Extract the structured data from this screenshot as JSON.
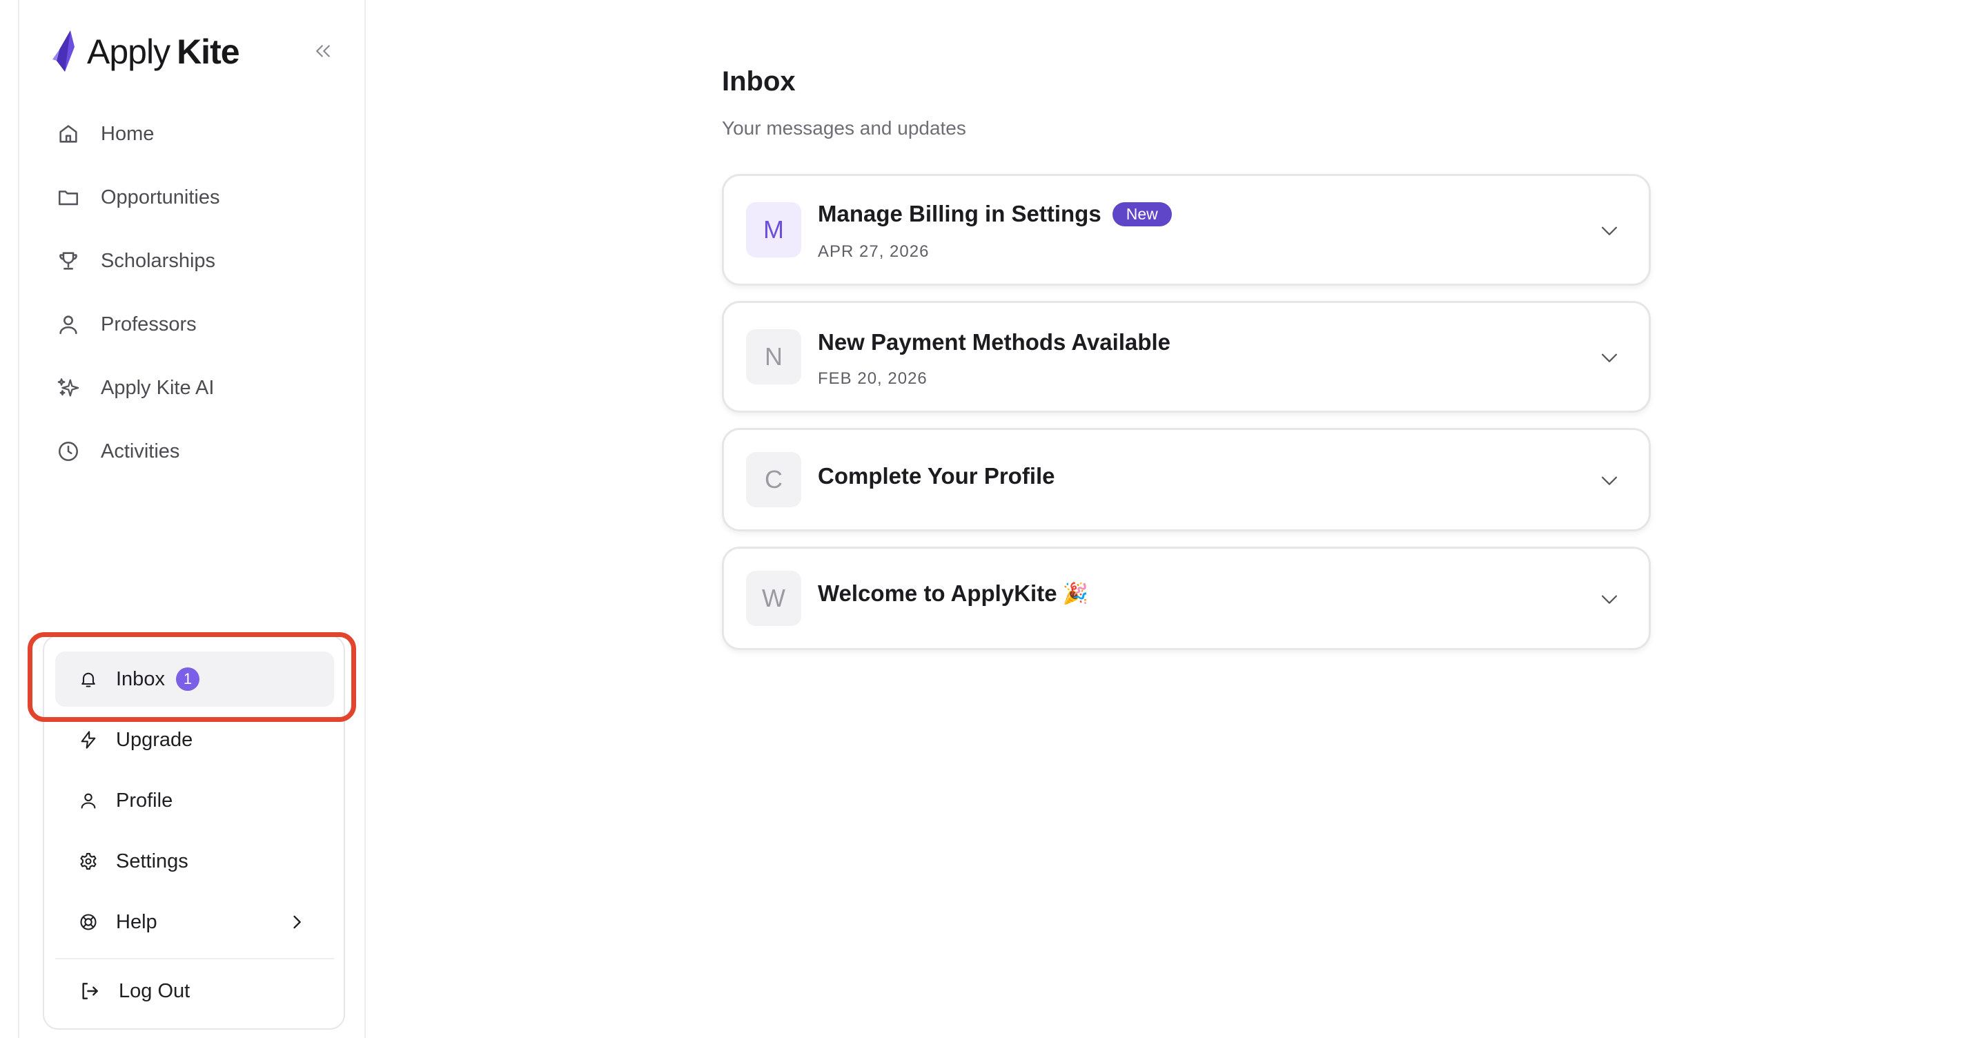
{
  "app": {
    "logo_word1": "Apply",
    "logo_word2": "Kite",
    "accent_color": "#7b5fe6",
    "highlight_color": "#e2452e"
  },
  "sidebar": {
    "collapse_icon": "chevrons-left-icon",
    "items": [
      {
        "label": "Home",
        "icon": "home-icon"
      },
      {
        "label": "Opportunities",
        "icon": "folder-icon"
      },
      {
        "label": "Scholarships",
        "icon": "trophy-icon"
      },
      {
        "label": "Professors",
        "icon": "user-icon"
      },
      {
        "label": "Apply Kite AI",
        "icon": "sparkles-icon"
      },
      {
        "label": "Activities",
        "icon": "clock-icon"
      }
    ]
  },
  "account_menu": {
    "inbox": {
      "label": "Inbox",
      "badge": "1",
      "icon": "bell-icon"
    },
    "upgrade": {
      "label": "Upgrade",
      "icon": "lightning-icon"
    },
    "profile": {
      "label": "Profile",
      "icon": "user-icon"
    },
    "settings": {
      "label": "Settings",
      "icon": "gear-icon"
    },
    "help": {
      "label": "Help",
      "icon": "lifebuoy-icon"
    },
    "logout": {
      "label": "Log Out",
      "icon": "logout-icon"
    }
  },
  "main": {
    "title": "Inbox",
    "subtitle": "Your messages and updates",
    "messages": [
      {
        "initial": "M",
        "title": "Manage Billing in Settings",
        "badge": "New",
        "date": "APR 27, 2026"
      },
      {
        "initial": "N",
        "title": "New Payment Methods Available",
        "date": "FEB 20, 2026"
      },
      {
        "initial": "C",
        "title": "Complete Your Profile"
      },
      {
        "initial": "W",
        "title": "Welcome to ApplyKite",
        "emoji": "🎉"
      }
    ]
  }
}
